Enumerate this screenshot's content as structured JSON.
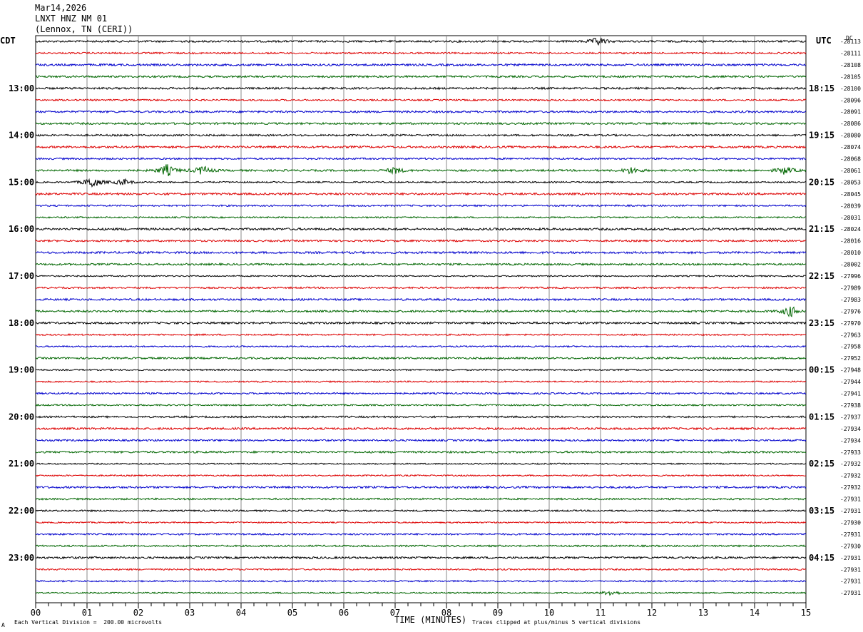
{
  "header": {
    "date": "Mar14,2026",
    "station": "LNXT HNZ NM 01",
    "location": "(Lennox, TN (CERI))"
  },
  "left_tz": "CDT",
  "right_tz": "UTC",
  "dc_label": "DC",
  "footer": {
    "scale": "Each Vertical Division =  200.00 microvolts",
    "xlabel": "TIME (MINUTES)",
    "clip": "Traces clipped at plus/minus 5 vertical divisions",
    "corner": "A"
  },
  "chart_data": {
    "type": "line",
    "title": "",
    "xlabel": "TIME (MINUTES)",
    "xlim": [
      0,
      15
    ],
    "x_ticks": [
      "00",
      "01",
      "02",
      "03",
      "04",
      "05",
      "06",
      "07",
      "08",
      "09",
      "10",
      "11",
      "12",
      "13",
      "14",
      "15"
    ],
    "grid": true,
    "colors": [
      "#000000",
      "#dd0000",
      "#0000cc",
      "#006600"
    ],
    "left_hour_labels": [
      "13:00",
      "14:00",
      "15:00",
      "16:00",
      "17:00",
      "18:00",
      "19:00",
      "20:00",
      "21:00",
      "22:00",
      "23:00"
    ],
    "right_hour_labels": [
      "18:15",
      "19:15",
      "20:15",
      "21:15",
      "22:15",
      "23:15",
      "00:15",
      "01:15",
      "02:15",
      "03:15",
      "04:15"
    ],
    "dc_offsets": [
      "-28113",
      "-28111",
      "-28108",
      "-28105",
      "-28100",
      "-28096",
      "-28091",
      "-28086",
      "-28080",
      "-28074",
      "-28068",
      "-28061",
      "-28053",
      "-28045",
      "-28039",
      "-28031",
      "-28024",
      "-28016",
      "-28010",
      "-28002",
      "-27996",
      "-27989",
      "-27983",
      "-27976",
      "-27970",
      "-27963",
      "-27958",
      "-27952",
      "-27948",
      "-27944",
      "-27941",
      "-27938",
      "-27937",
      "-27934",
      "-27934",
      "-27933",
      "-27932",
      "-27932",
      "-27932",
      "-27931",
      "-27931",
      "-27930",
      "-27931",
      "-27930",
      "-27931",
      "-27931",
      "-27931",
      "-27931"
    ],
    "trace_count": 48,
    "events": [
      {
        "trace": 0,
        "minute": 10.95,
        "amplitude": 6
      },
      {
        "trace": 11,
        "minute": 2.55,
        "amplitude": 9
      },
      {
        "trace": 11,
        "minute": 3.25,
        "amplitude": 7
      },
      {
        "trace": 11,
        "minute": 7.0,
        "amplitude": 5
      },
      {
        "trace": 11,
        "minute": 11.6,
        "amplitude": 5
      },
      {
        "trace": 11,
        "minute": 14.6,
        "amplitude": 6
      },
      {
        "trace": 12,
        "minute": 1.1,
        "amplitude": 9
      },
      {
        "trace": 12,
        "minute": 1.7,
        "amplitude": 5
      },
      {
        "trace": 23,
        "minute": 14.7,
        "amplitude": 8
      },
      {
        "trace": 47,
        "minute": 11.2,
        "amplitude": 4
      }
    ]
  }
}
